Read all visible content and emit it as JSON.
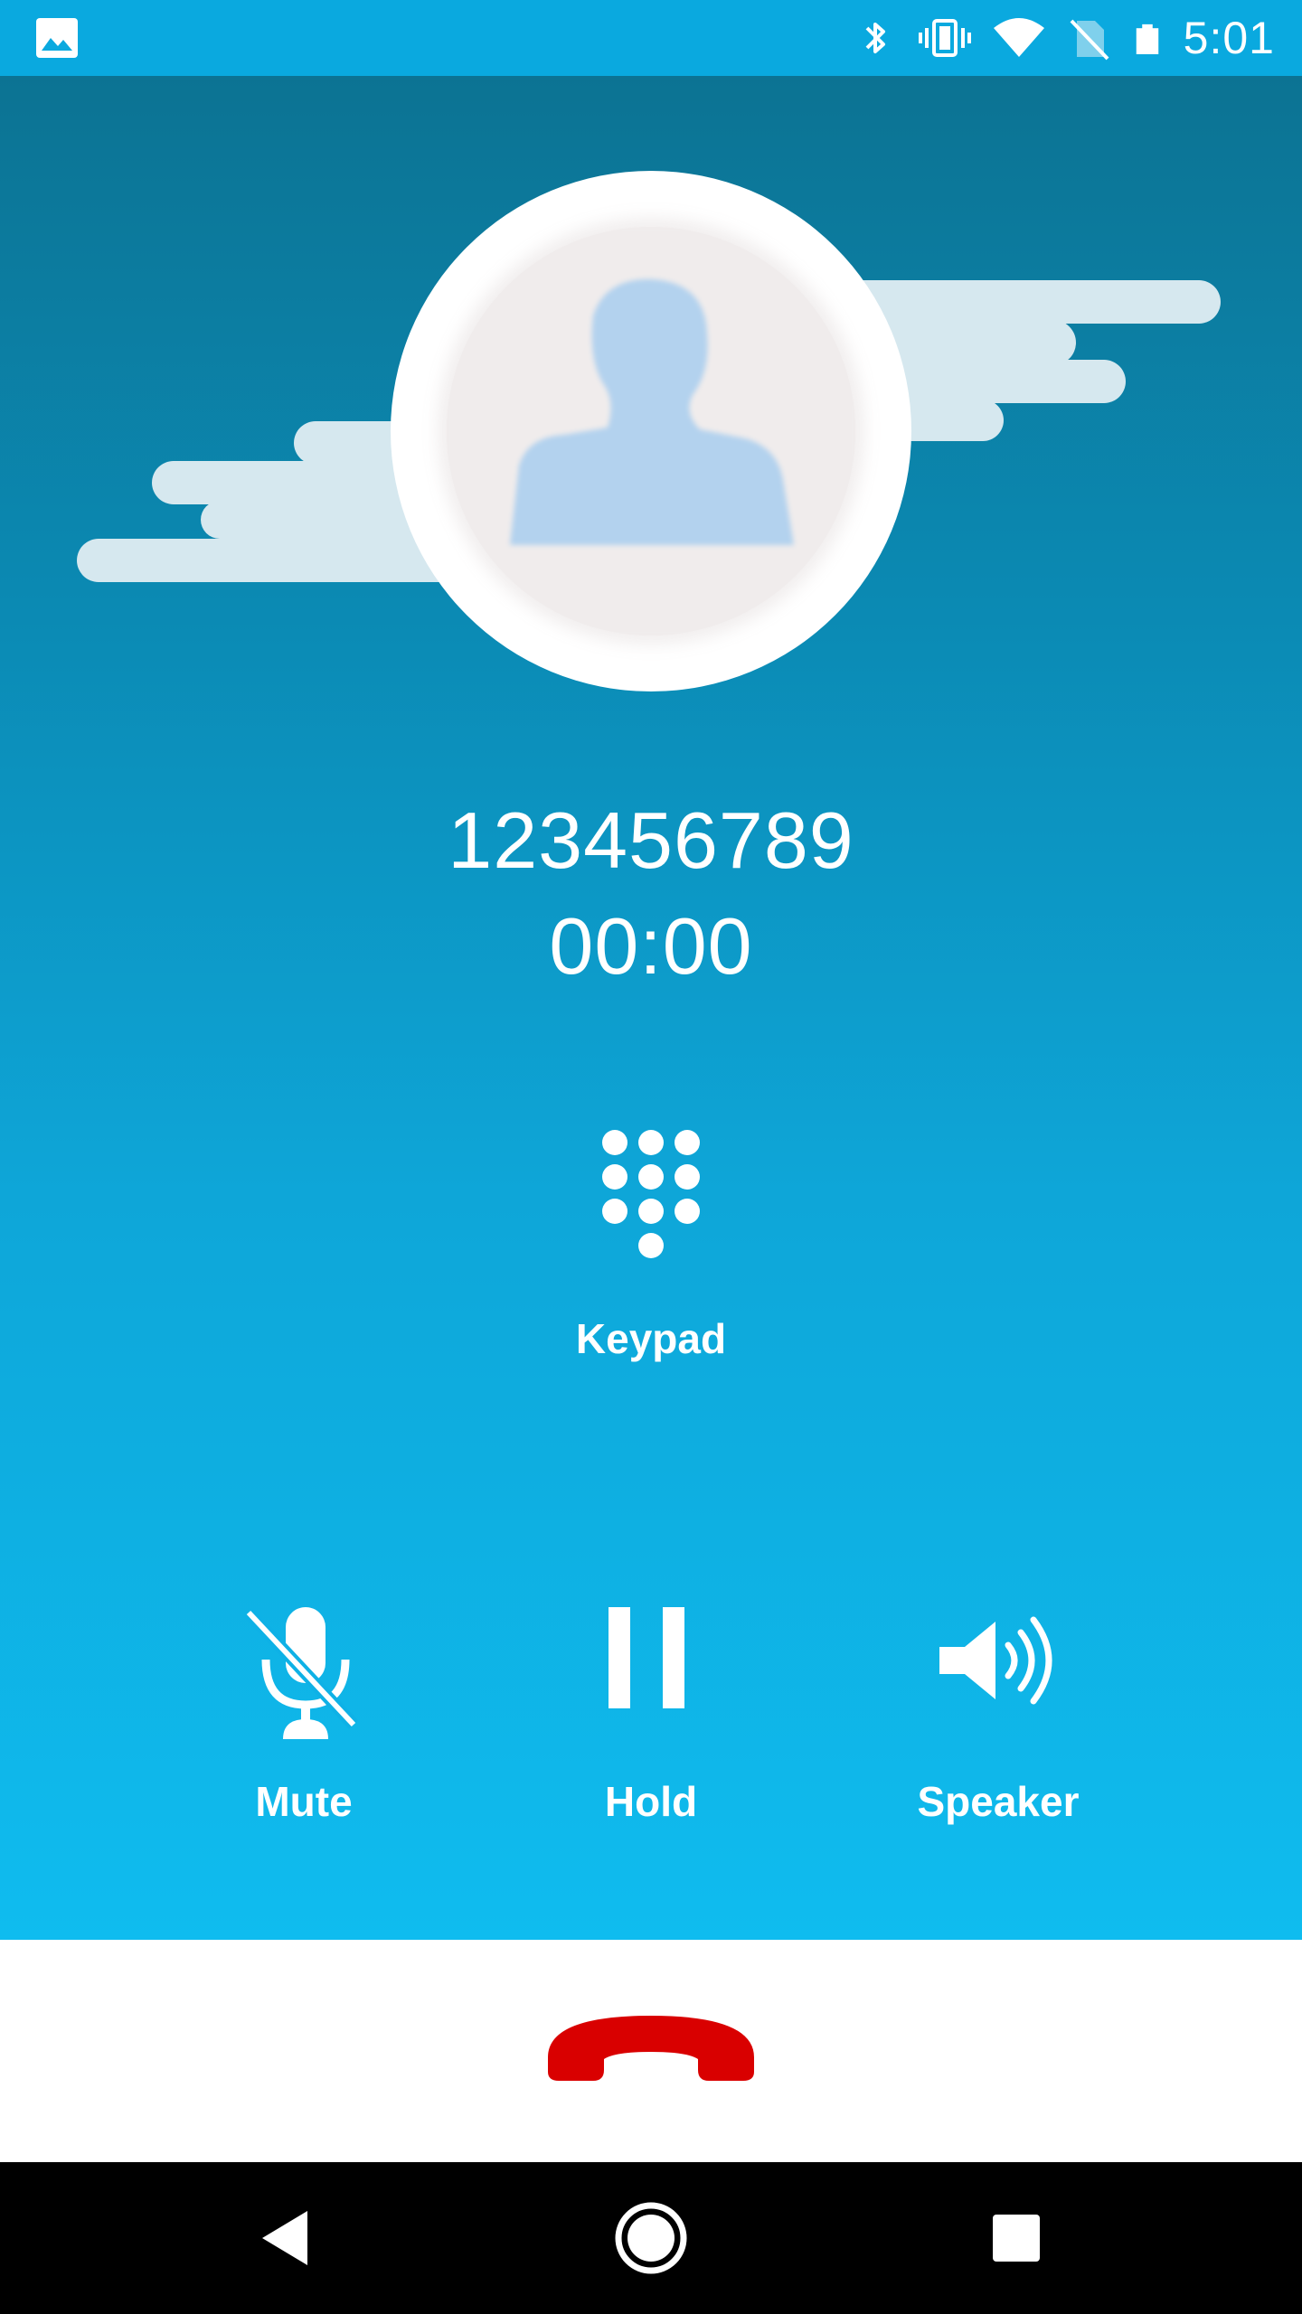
{
  "status_bar": {
    "time": "5:01",
    "icons": [
      "image-icon",
      "bluetooth-icon",
      "vibrate-icon",
      "wifi-icon",
      "no-sim-icon",
      "battery-icon"
    ]
  },
  "call": {
    "number": "123456789",
    "timer": "00:00",
    "avatar_icon": "person-icon"
  },
  "controls": {
    "keypad_label": "Keypad",
    "mute_label": "Mute",
    "hold_label": "Hold",
    "speaker_label": "Speaker"
  },
  "end_call": {
    "icon": "end-call-icon",
    "color": "#d90000"
  },
  "nav": {
    "back_icon": "back-icon",
    "home_icon": "home-icon",
    "recents_icon": "recents-icon"
  },
  "colors": {
    "status_bar": "#0aa9df",
    "gradient_top": "#0c7393",
    "gradient_bottom": "#0fbcef",
    "cloud": "#d6e8ef",
    "avatar_person": "#b3d2ee"
  }
}
